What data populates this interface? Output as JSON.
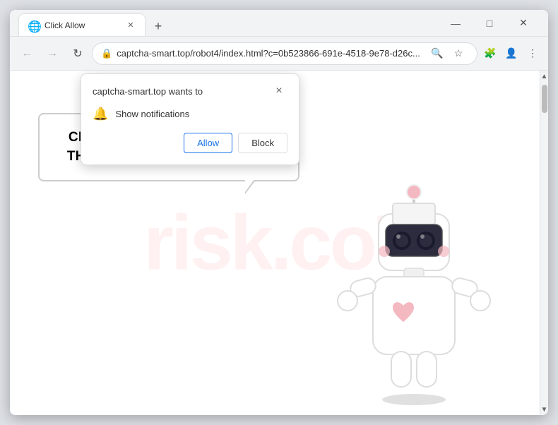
{
  "browser": {
    "tab": {
      "title": "Click Allow",
      "favicon": "🌐"
    },
    "controls": {
      "minimize": "—",
      "maximize": "□",
      "close": "✕",
      "new_tab": "+",
      "back": "←",
      "forward": "→",
      "reload": "↻",
      "back_disabled": true,
      "forward_disabled": true
    },
    "address": {
      "url": "captcha-smart.top/robot4/index.html?c=0b523866-691e-4518-9e78-d26c...",
      "lock_icon": "🔒"
    },
    "toolbar_icons": {
      "search": "🔍",
      "star": "☆",
      "account": "👤",
      "menu": "⋮",
      "extensions": "🧩"
    }
  },
  "notification_popup": {
    "site_text": "captcha-smart.top wants to",
    "close_icon": "×",
    "notification_row": {
      "icon": "🔔",
      "label": "Show notifications"
    },
    "allow_button": "Allow",
    "block_button": "Block"
  },
  "page": {
    "watermark_text": "risk.co7",
    "speech_bubble_text": "CLICK «ALLOW» TO CONFIRM THAT YOU ARE NOT A ROBOT!"
  },
  "colors": {
    "allow_btn_border": "#1a73e8",
    "allow_btn_text": "#1a73e8",
    "block_btn_border": "#dadce0",
    "speech_text": "#000000"
  }
}
